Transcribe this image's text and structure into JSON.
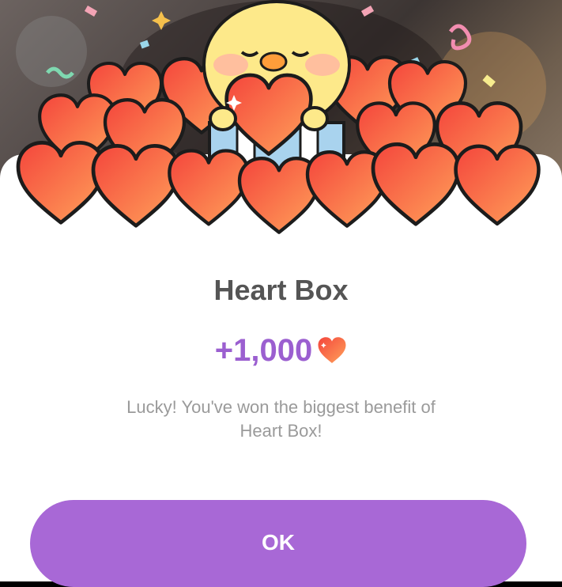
{
  "dialog": {
    "title": "Heart Box",
    "amount": "+1,000",
    "message_line1": "Lucky! You've won the biggest benefit of",
    "message_line2": "Heart Box!",
    "ok_label": "OK"
  },
  "icons": {
    "illustration": "chick-holding-heart-icon",
    "amount": "heart-icon",
    "decorations": "confetti-icon"
  },
  "colors": {
    "accent": "#a868d6",
    "amount_text": "#9b5fd0",
    "title_text": "#555555",
    "message_text": "#9a9a9a",
    "heart": "#f56c4e",
    "chick": "#fde98a"
  }
}
